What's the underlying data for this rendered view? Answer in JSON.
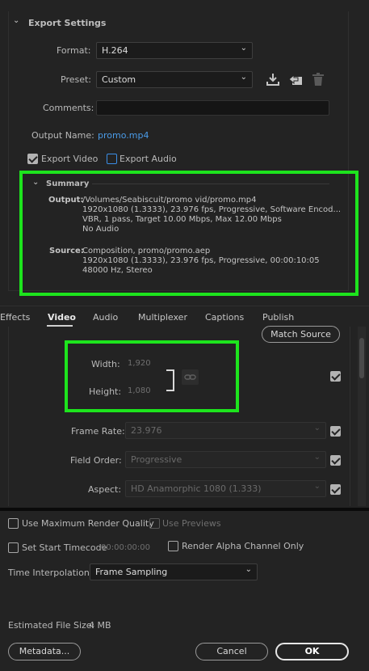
{
  "export_settings": {
    "header": "Export Settings",
    "format_label": "Format:",
    "format_value": "H.264",
    "preset_label": "Preset:",
    "preset_value": "Custom",
    "comments_label": "Comments:",
    "comments_value": "",
    "output_name_label": "Output Name:",
    "output_name_value": "promo.mp4",
    "export_video_label": "Export Video",
    "export_video_checked": true,
    "export_audio_label": "Export Audio",
    "export_audio_checked": false
  },
  "summary": {
    "header": "Summary",
    "output_key": "Output:",
    "output_lines": [
      "/Volumes/Seabiscuit/promo vid/promo.mp4",
      "1920x1080 (1.3333), 23.976 fps, Progressive, Software Encod...",
      "VBR, 1 pass, Target 10.00 Mbps, Max 12.00 Mbps",
      "No Audio"
    ],
    "source_key": "Source:",
    "source_lines": [
      "Composition, promo/promo.aep",
      "1920x1080 (1.3333), 23.976 fps, Progressive, 00:00:10:05",
      "48000 Hz, Stereo"
    ]
  },
  "tabs": {
    "items": [
      "Effects",
      "Video",
      "Audio",
      "Multiplexer",
      "Captions",
      "Publish"
    ],
    "active": "Video"
  },
  "video": {
    "match_source_label": "Match Source",
    "width_label": "Width:",
    "width_value": "1,920",
    "height_label": "Height:",
    "height_value": "1,080",
    "frame_rate_label": "Frame Rate:",
    "frame_rate_value": "23.976",
    "field_order_label": "Field Order:",
    "field_order_value": "Progressive",
    "aspect_label": "Aspect:",
    "aspect_value": "HD Anamorphic 1080 (1.333)"
  },
  "render_options": {
    "max_render_quality_label": "Use Maximum Render Quality",
    "use_previews_label": "Use Previews",
    "set_start_timecode_label": "Set Start Timecode",
    "start_timecode_value": "00:00:00:00",
    "render_alpha_label": "Render Alpha Channel Only",
    "time_interpolation_label": "Time Interpolation:",
    "time_interpolation_value": "Frame Sampling",
    "estimated_size_label": "Estimated File Size:",
    "estimated_size_value": "4 MB"
  },
  "footer": {
    "metadata_label": "Metadata...",
    "cancel_label": "Cancel",
    "ok_label": "OK"
  },
  "colors": {
    "highlight_box": "#1de41d",
    "link_blue": "#4a9be8",
    "background": "#232323"
  },
  "icons": {
    "chevron": "chevron-down-icon",
    "import_preset": "import-preset-icon",
    "save_preset": "save-preset-icon",
    "delete_preset": "trash-icon",
    "link": "link-icon"
  }
}
